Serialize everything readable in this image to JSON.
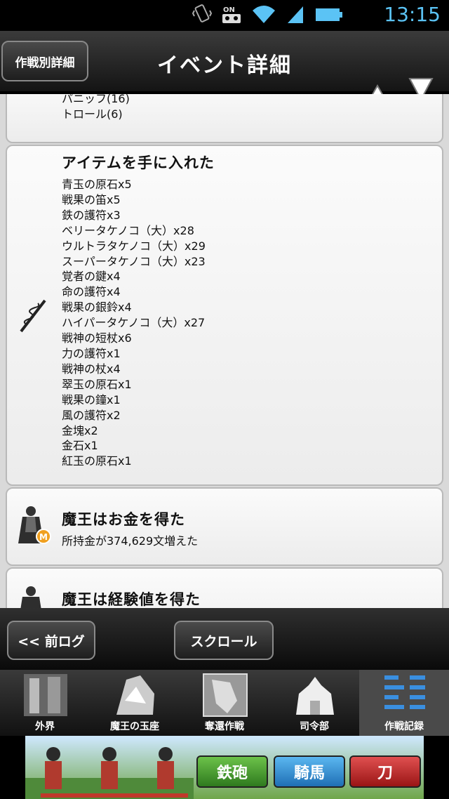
{
  "status_bar": {
    "time": "13:15",
    "icons": [
      "vibrate-icon",
      "voicemail-icon",
      "wifi-icon",
      "signal-icon",
      "battery-icon"
    ]
  },
  "header": {
    "left_button": "作戦別詳細",
    "title": "イベント詳細"
  },
  "cards": {
    "partial_top": {
      "lines": [
        "パニッフ(16)",
        "トロール(6)"
      ]
    },
    "items": {
      "heading": "アイテムを手に入れた",
      "lines": [
        "青玉の原石x5",
        "戦果の笛x5",
        "鉄の護符x3",
        "ベリータケノコ（大）x28",
        "ウルトラタケノコ（大）x29",
        "スーパータケノコ（大）x23",
        "覚者の鍵x4",
        "命の護符x4",
        "戦果の銀鈴x4",
        "ハイパータケノコ（大）x27",
        "戦神の短杖x6",
        "力の護符x1",
        "戦神の杖x4",
        "翠玉の原石x1",
        "戦果の鐘x1",
        "風の護符x2",
        "金塊x2",
        "金石x1",
        "紅玉の原石x1"
      ]
    },
    "money": {
      "heading": "魔王はお金を得た",
      "line": "所持金が374,629文増えた",
      "coin_letter": "M"
    },
    "exp": {
      "heading": "魔王は経験値を得た"
    }
  },
  "nav": {
    "prev_log": "<< 前ログ",
    "scroll": "スクロール"
  },
  "tabs": [
    {
      "label": "外界"
    },
    {
      "label": "魔王の玉座"
    },
    {
      "label": "奪還作戦"
    },
    {
      "label": "司令部"
    },
    {
      "label": "作戦記録"
    }
  ],
  "ad": {
    "buttons": [
      "鉄砲",
      "騎馬",
      "刀"
    ]
  },
  "colors": {
    "accent": "#5bc3f5",
    "header": "#1e1e1e",
    "card": "#f4f4f4"
  }
}
